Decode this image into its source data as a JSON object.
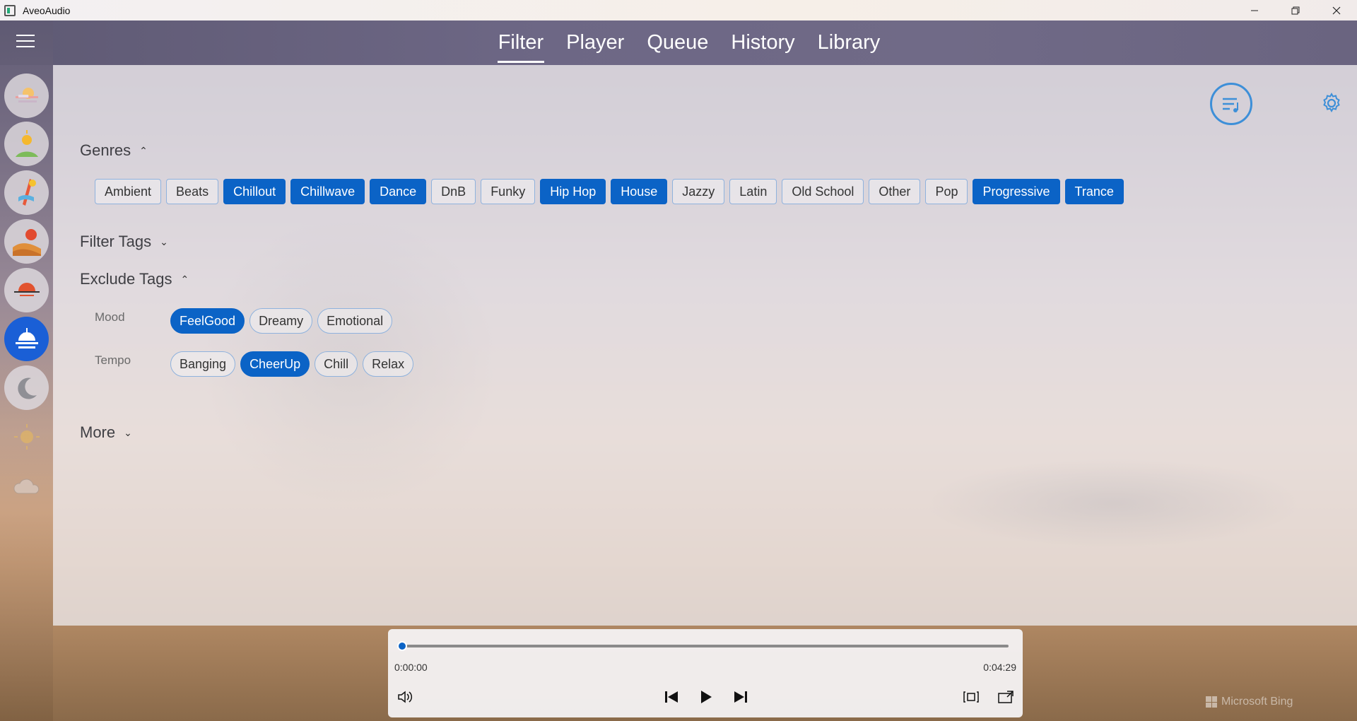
{
  "window": {
    "title": "AveoAudio",
    "controls": [
      "minimize",
      "restore",
      "close"
    ]
  },
  "nav": {
    "tabs": [
      {
        "label": "Filter",
        "active": true
      },
      {
        "label": "Player",
        "active": false
      },
      {
        "label": "Queue",
        "active": false
      },
      {
        "label": "History",
        "active": false
      },
      {
        "label": "Library",
        "active": false
      }
    ]
  },
  "rail": {
    "items": [
      {
        "name": "sunrise-cloud-icon",
        "active": false
      },
      {
        "name": "sun-landscape-icon",
        "active": false
      },
      {
        "name": "surf-icon",
        "active": false
      },
      {
        "name": "desert-sun-icon",
        "active": false
      },
      {
        "name": "sunset-horizon-icon",
        "active": false
      },
      {
        "name": "sun-down-icon",
        "active": true
      },
      {
        "name": "moon-icon",
        "active": false
      },
      {
        "name": "sun-icon",
        "active": false
      },
      {
        "name": "cloud-icon",
        "active": false
      }
    ]
  },
  "filter": {
    "genres": {
      "heading": "Genres",
      "items": [
        {
          "label": "Ambient",
          "on": false
        },
        {
          "label": "Beats",
          "on": false
        },
        {
          "label": "Chillout",
          "on": true
        },
        {
          "label": "Chillwave",
          "on": true
        },
        {
          "label": "Dance",
          "on": true
        },
        {
          "label": "DnB",
          "on": false
        },
        {
          "label": "Funky",
          "on": false
        },
        {
          "label": "Hip Hop",
          "on": true
        },
        {
          "label": "House",
          "on": true
        },
        {
          "label": "Jazzy",
          "on": false
        },
        {
          "label": "Latin",
          "on": false
        },
        {
          "label": "Old School",
          "on": false
        },
        {
          "label": "Other",
          "on": false
        },
        {
          "label": "Pop",
          "on": false
        },
        {
          "label": "Progressive",
          "on": true
        },
        {
          "label": "Trance",
          "on": true
        }
      ]
    },
    "filter_tags": {
      "heading": "Filter Tags"
    },
    "exclude_tags": {
      "heading": "Exclude Tags",
      "mood": {
        "label": "Mood",
        "items": [
          {
            "label": "FeelGood",
            "on": true
          },
          {
            "label": "Dreamy",
            "on": false
          },
          {
            "label": "Emotional",
            "on": false
          }
        ]
      },
      "tempo": {
        "label": "Tempo",
        "items": [
          {
            "label": "Banging",
            "on": false
          },
          {
            "label": "CheerUp",
            "on": true
          },
          {
            "label": "Chill",
            "on": false
          },
          {
            "label": "Relax",
            "on": false
          }
        ]
      }
    },
    "more": {
      "heading": "More"
    }
  },
  "player": {
    "elapsed": "0:00:00",
    "duration": "0:04:29",
    "progress": 0.0
  },
  "watermark": "Microsoft Bing",
  "colors": {
    "accent": "#0b63c6",
    "chip_border": "#8fb2dd"
  }
}
